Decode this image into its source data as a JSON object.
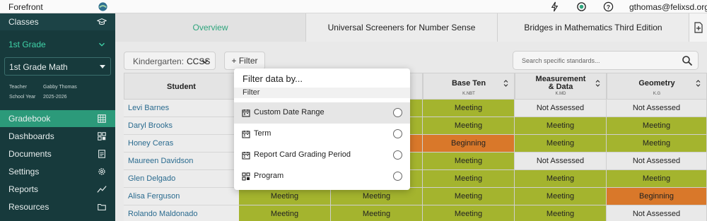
{
  "topbar": {
    "brand": "Forefront",
    "user_email": "gthomas@felixsd.org"
  },
  "sidebar": {
    "classes_label": "Classes",
    "grade_label": "1st Grade",
    "course_value": "1st Grade Math",
    "teacher_label": "Teacher",
    "teacher_value": "Gabby Thomas",
    "school_year_label": "School Year",
    "school_year_value": "2025-2026",
    "nav": [
      {
        "label": "Gradebook",
        "icon": "grid-icon",
        "active": true
      },
      {
        "label": "Dashboards",
        "icon": "dashboard-icon"
      },
      {
        "label": "Documents",
        "icon": "document-icon"
      },
      {
        "label": "Settings",
        "icon": "gear-icon"
      },
      {
        "label": "Reports",
        "icon": "trend-icon"
      },
      {
        "label": "Resources",
        "icon": "folder-icon"
      }
    ]
  },
  "tabs": [
    {
      "label": "Overview",
      "active": true
    },
    {
      "label": "Universal Screeners for Number Sense"
    },
    {
      "label": "Bridges in Mathematics Third Edition"
    }
  ],
  "controls": {
    "standard_label": "Kindergarten:",
    "standard_value": "CCSS",
    "add_filter_label": "+ Filter",
    "search_placeholder": "Search specific standards..."
  },
  "grid": {
    "student_header": "Student",
    "columns": [
      {
        "title": "Base Ten",
        "code": "K.NBT"
      },
      {
        "title": "Measurement & Data",
        "code": "K.MD"
      },
      {
        "title": "Geometry",
        "code": "K.G"
      }
    ],
    "rows": [
      {
        "name": "Levi Barnes",
        "c1": "",
        "c2": "",
        "c3": "Meeting",
        "c4": "Not Assessed",
        "c5": "Not Assessed"
      },
      {
        "name": "Daryl Brooks",
        "c1": "",
        "c2": "",
        "c3": "Meeting",
        "c4": "Meeting",
        "c5": "Meeting"
      },
      {
        "name": "Honey Ceras",
        "c1": "",
        "c2": "",
        "c3": "Beginning",
        "c4": "Meeting",
        "c5": "Meeting"
      },
      {
        "name": "Maureen Davidson",
        "c1": "",
        "c2": "",
        "c3": "Meeting",
        "c4": "Not Assessed",
        "c5": "Not Assessed"
      },
      {
        "name": "Glen Delgado",
        "c1": "",
        "c2": "",
        "c3": "Meeting",
        "c4": "Meeting",
        "c5": "Meeting"
      },
      {
        "name": "Alisa Ferguson",
        "c1": "Meeting",
        "c2": "Meeting",
        "c3": "Meeting",
        "c4": "Meeting",
        "c5": "Beginning"
      },
      {
        "name": "Rolando Maldonado",
        "c1": "Meeting",
        "c2": "Meeting",
        "c3": "Meeting",
        "c4": "Meeting",
        "c5": "Not Assessed"
      }
    ]
  },
  "popover": {
    "title": "Filter data by...",
    "section": "Filter",
    "options": [
      {
        "label": "Custom Date Range",
        "icon": "calendar-icon"
      },
      {
        "label": "Term",
        "icon": "calendar-icon"
      },
      {
        "label": "Report Card Grading Period",
        "icon": "calendar-icon"
      },
      {
        "label": "Program",
        "icon": "program-icon"
      }
    ]
  },
  "colors": {
    "sidebar_bg": "#173a3c",
    "accent": "#2c9a7a",
    "meeting": "#a4b42e",
    "beginning": "#d9782a"
  }
}
